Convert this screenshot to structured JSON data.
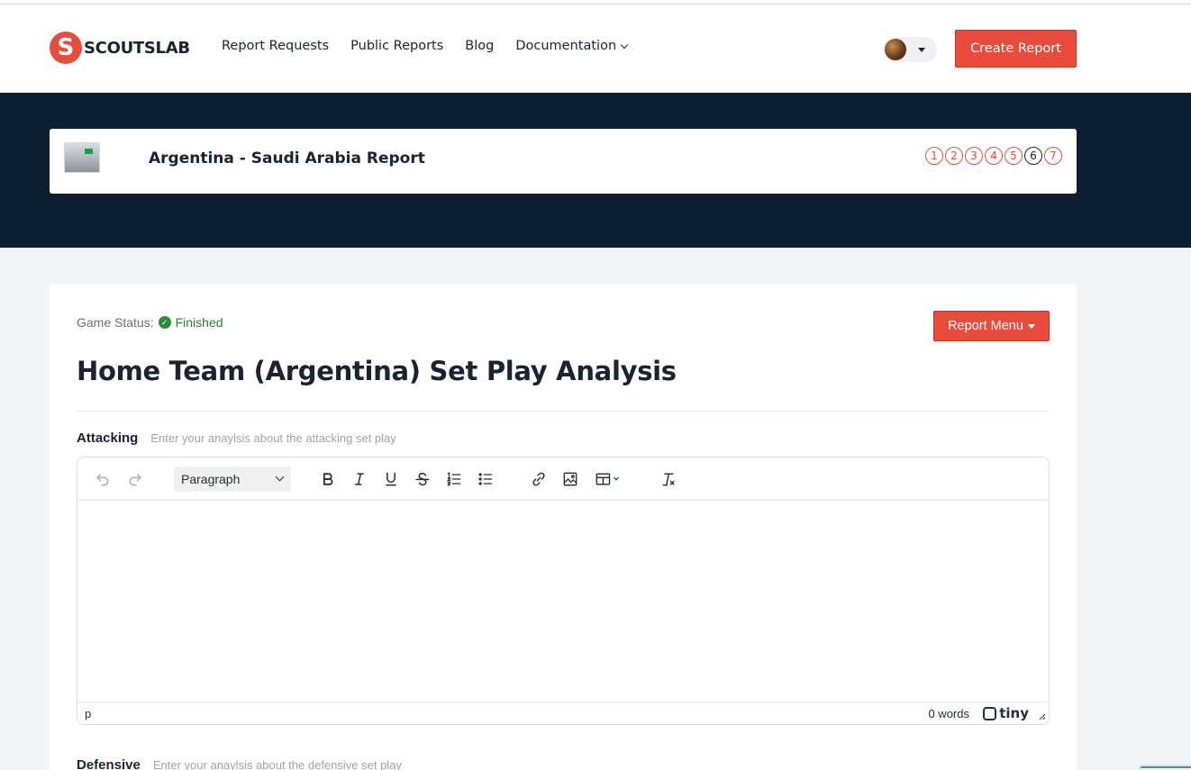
{
  "brand": {
    "logo_letter": "S",
    "name": "SCOUTSLAB"
  },
  "nav": [
    {
      "label": "Report Requests"
    },
    {
      "label": "Public Reports"
    },
    {
      "label": "Blog"
    },
    {
      "label": "Documentation"
    }
  ],
  "header": {
    "create_label": "Create Report"
  },
  "report": {
    "title": "Argentina - Saudi Arabia Report",
    "steps": [
      "1",
      "2",
      "3",
      "4",
      "5",
      "6",
      "7"
    ],
    "current_step": 6
  },
  "main": {
    "status_label": "Game Status:",
    "status_value": "Finished",
    "menu_label": "Report Menu",
    "title": "Home Team (Argentina) Set Play Analysis"
  },
  "fields": [
    {
      "label": "Attacking",
      "hint": "Enter your anaylsis about the attacking set play"
    },
    {
      "label": "Defensive",
      "hint": "Enter your anaylsis about the defensive set play"
    }
  ],
  "editor": {
    "block_format": "Paragraph",
    "path": "p",
    "word_count": "0 words",
    "brand": "tiny"
  },
  "colors": {
    "accent": "#e94b3c",
    "navy": "#0d1e31",
    "success": "#2e8b3e"
  }
}
